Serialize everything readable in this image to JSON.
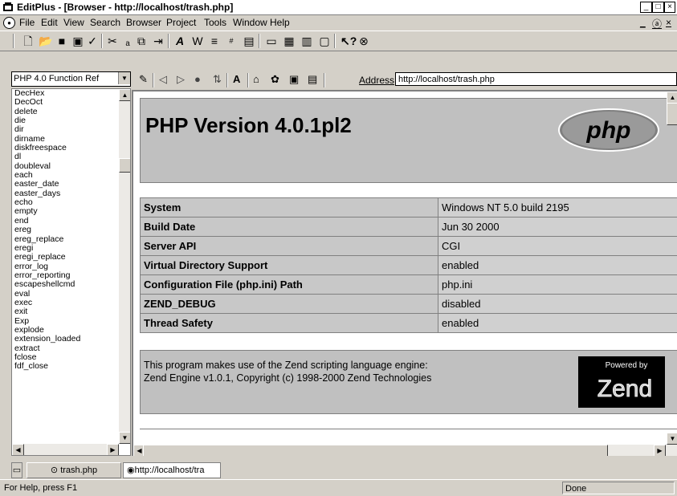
{
  "window": {
    "title": "EditPlus - [Browser - http://localhost/trash.php]",
    "controls": [
      "_",
      "□",
      "×"
    ]
  },
  "menu": [
    "File",
    "Edit",
    "View",
    "Search",
    "Browser",
    "Project",
    "Tools",
    "Window",
    "Help"
  ],
  "mdi_controls": [
    "_",
    "ⓐ",
    "×"
  ],
  "left_panel": {
    "selector_value": "PHP 4.0 Function Ref",
    "functions": [
      "DecHex",
      "DecOct",
      "delete",
      "die",
      "dir",
      "dirname",
      "diskfreespace",
      "dl",
      "doubleval",
      "each",
      "easter_date",
      "easter_days",
      "echo",
      "empty",
      "end",
      "ereg",
      "ereg_replace",
      "eregi",
      "eregi_replace",
      "error_log",
      "error_reporting",
      "escapeshellcmd",
      "eval",
      "exec",
      "exit",
      "Exp",
      "explode",
      "extension_loaded",
      "extract",
      "fclose",
      "fdf_close"
    ]
  },
  "browser": {
    "address_label": "Address",
    "address_value": "http://localhost/trash.php"
  },
  "page": {
    "heading": "PHP Version 4.0.1pl2",
    "logo_text": "php",
    "info_rows": [
      {
        "key": "System",
        "value": "Windows NT 5.0 build 2195"
      },
      {
        "key": "Build Date",
        "value": "Jun 30 2000"
      },
      {
        "key": "Server API",
        "value": "CGI"
      },
      {
        "key": "Virtual Directory Support",
        "value": "enabled"
      },
      {
        "key": "Configuration File (php.ini) Path",
        "value": "php.ini"
      },
      {
        "key": "ZEND_DEBUG",
        "value": "disabled"
      },
      {
        "key": "Thread Safety",
        "value": "enabled"
      }
    ],
    "zend_line1": "This program makes use of the Zend scripting language engine:",
    "zend_line2": "Zend Engine v1.0.1, Copyright (c) 1998-2000 Zend Technologies",
    "zend_logo_small": "Powered by",
    "zend_logo_big": "Zend"
  },
  "tabs": [
    {
      "label": "trash.php"
    },
    {
      "label": "http://localhost/tra"
    }
  ],
  "status": {
    "help": "For Help, press F1",
    "state": "Done"
  }
}
